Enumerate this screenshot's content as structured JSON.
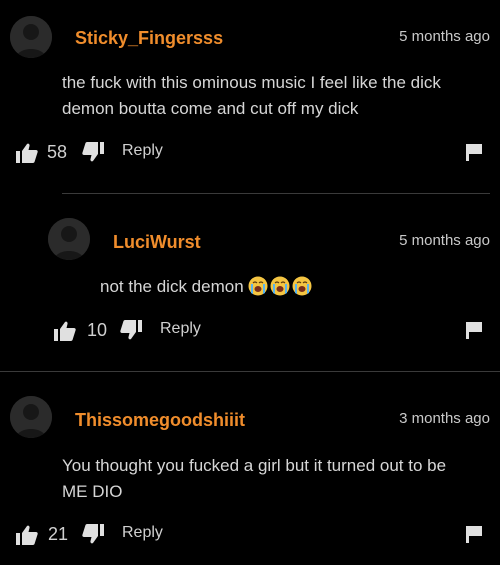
{
  "comments": [
    {
      "username": "Sticky_Fingersss",
      "timestamp": "5 months ago",
      "text_line1": "the fuck with this ominous music I feel like the dick",
      "text_line2": "demon boutta come and cut off my dick",
      "likes": "58",
      "reply_label": "Reply"
    },
    {
      "username": "LuciWurst",
      "timestamp": "5 months ago",
      "text": "not the dick demon",
      "emoji": "loudly-crying-face x3",
      "likes": "10",
      "reply_label": "Reply"
    },
    {
      "username": "Thissomegoodshiiit",
      "timestamp": "3 months ago",
      "text_line1": "You thought you fucked a girl but it turned out to be",
      "text_line2": "ME DIO",
      "likes": "21",
      "reply_label": "Reply"
    }
  ],
  "colors": {
    "background": "#000000",
    "username": "#f08d2c",
    "text": "#d6d6d6",
    "divider": "#3a3a3a"
  },
  "icons": [
    "avatar-placeholder",
    "thumbs-up-icon",
    "thumbs-down-icon",
    "flag-icon",
    "crying-emoji-icon"
  ]
}
